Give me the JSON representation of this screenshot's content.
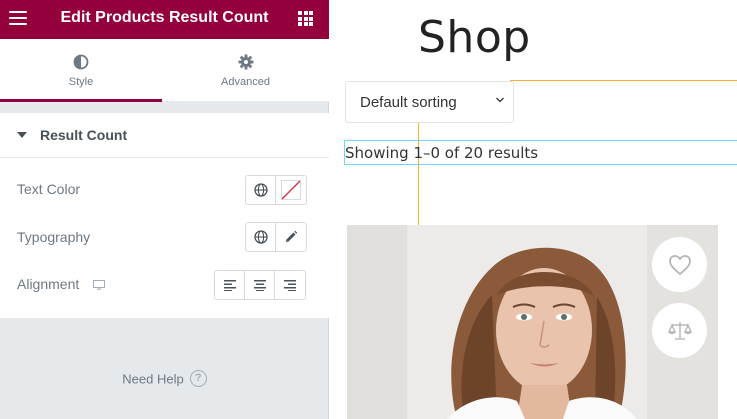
{
  "editor": {
    "title": "Edit Products Result Count",
    "menu_icon": "hamburger-icon",
    "apps_icon": "grid-icon",
    "tabs": [
      {
        "label": "Style",
        "icon": "contrast-icon",
        "active": true
      },
      {
        "label": "Advanced",
        "icon": "gear-icon",
        "active": false
      }
    ],
    "section": {
      "title": "Result Count",
      "expanded": true
    },
    "controls": {
      "text_color": "Text Color",
      "typography": "Typography",
      "alignment": "Alignment"
    },
    "help_label": "Need Help",
    "accent_color": "#93003c"
  },
  "preview": {
    "page_title": "Shop",
    "sorting": {
      "selected": "Default sorting"
    },
    "result_count": "Showing 1–0 of 20 results",
    "product_actions": [
      "heart-icon",
      "compare-icon"
    ]
  }
}
